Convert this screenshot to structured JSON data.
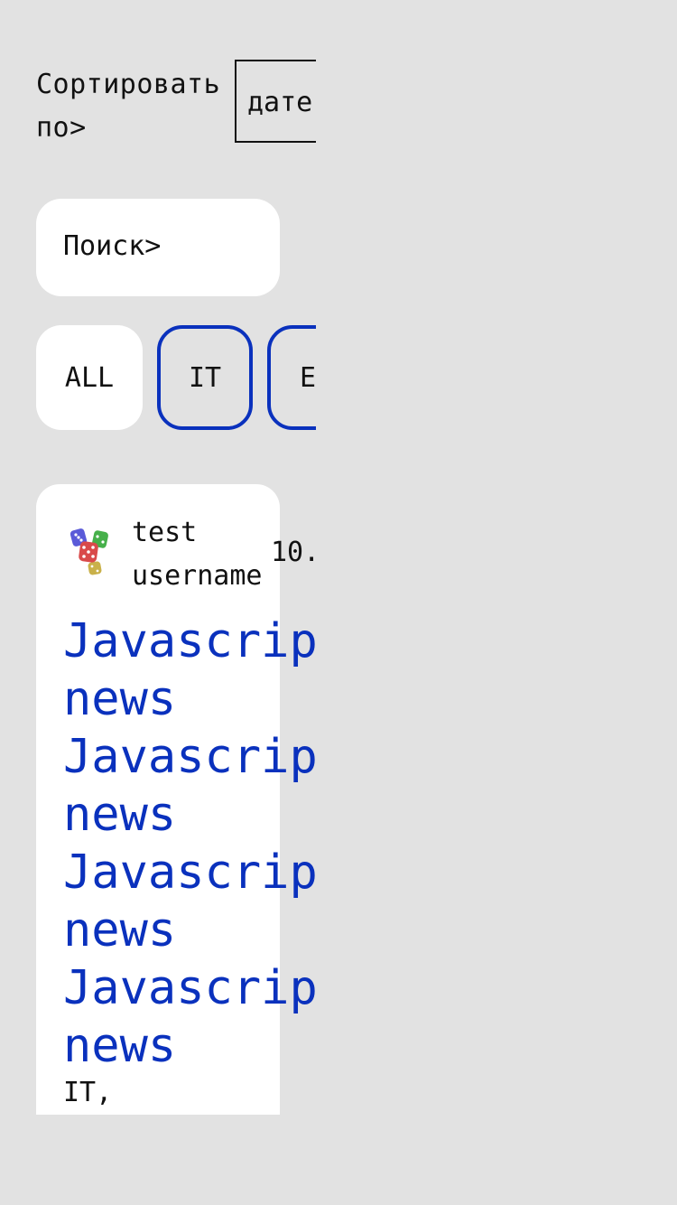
{
  "sort": {
    "label": "Сортировать по>",
    "selected": "дате"
  },
  "search": {
    "placeholder": "Поиск>"
  },
  "filters": {
    "items": [
      "ALL",
      "IT",
      "E"
    ],
    "accent_color": "#0a31bd"
  },
  "post": {
    "username": "test username",
    "date": "10.",
    "title": "Javascript news Javascript news Javascript news Javascript news",
    "tags": "IT,",
    "avatar_icon": "dice-avatar-icon",
    "title_color": "#0a31bd"
  }
}
